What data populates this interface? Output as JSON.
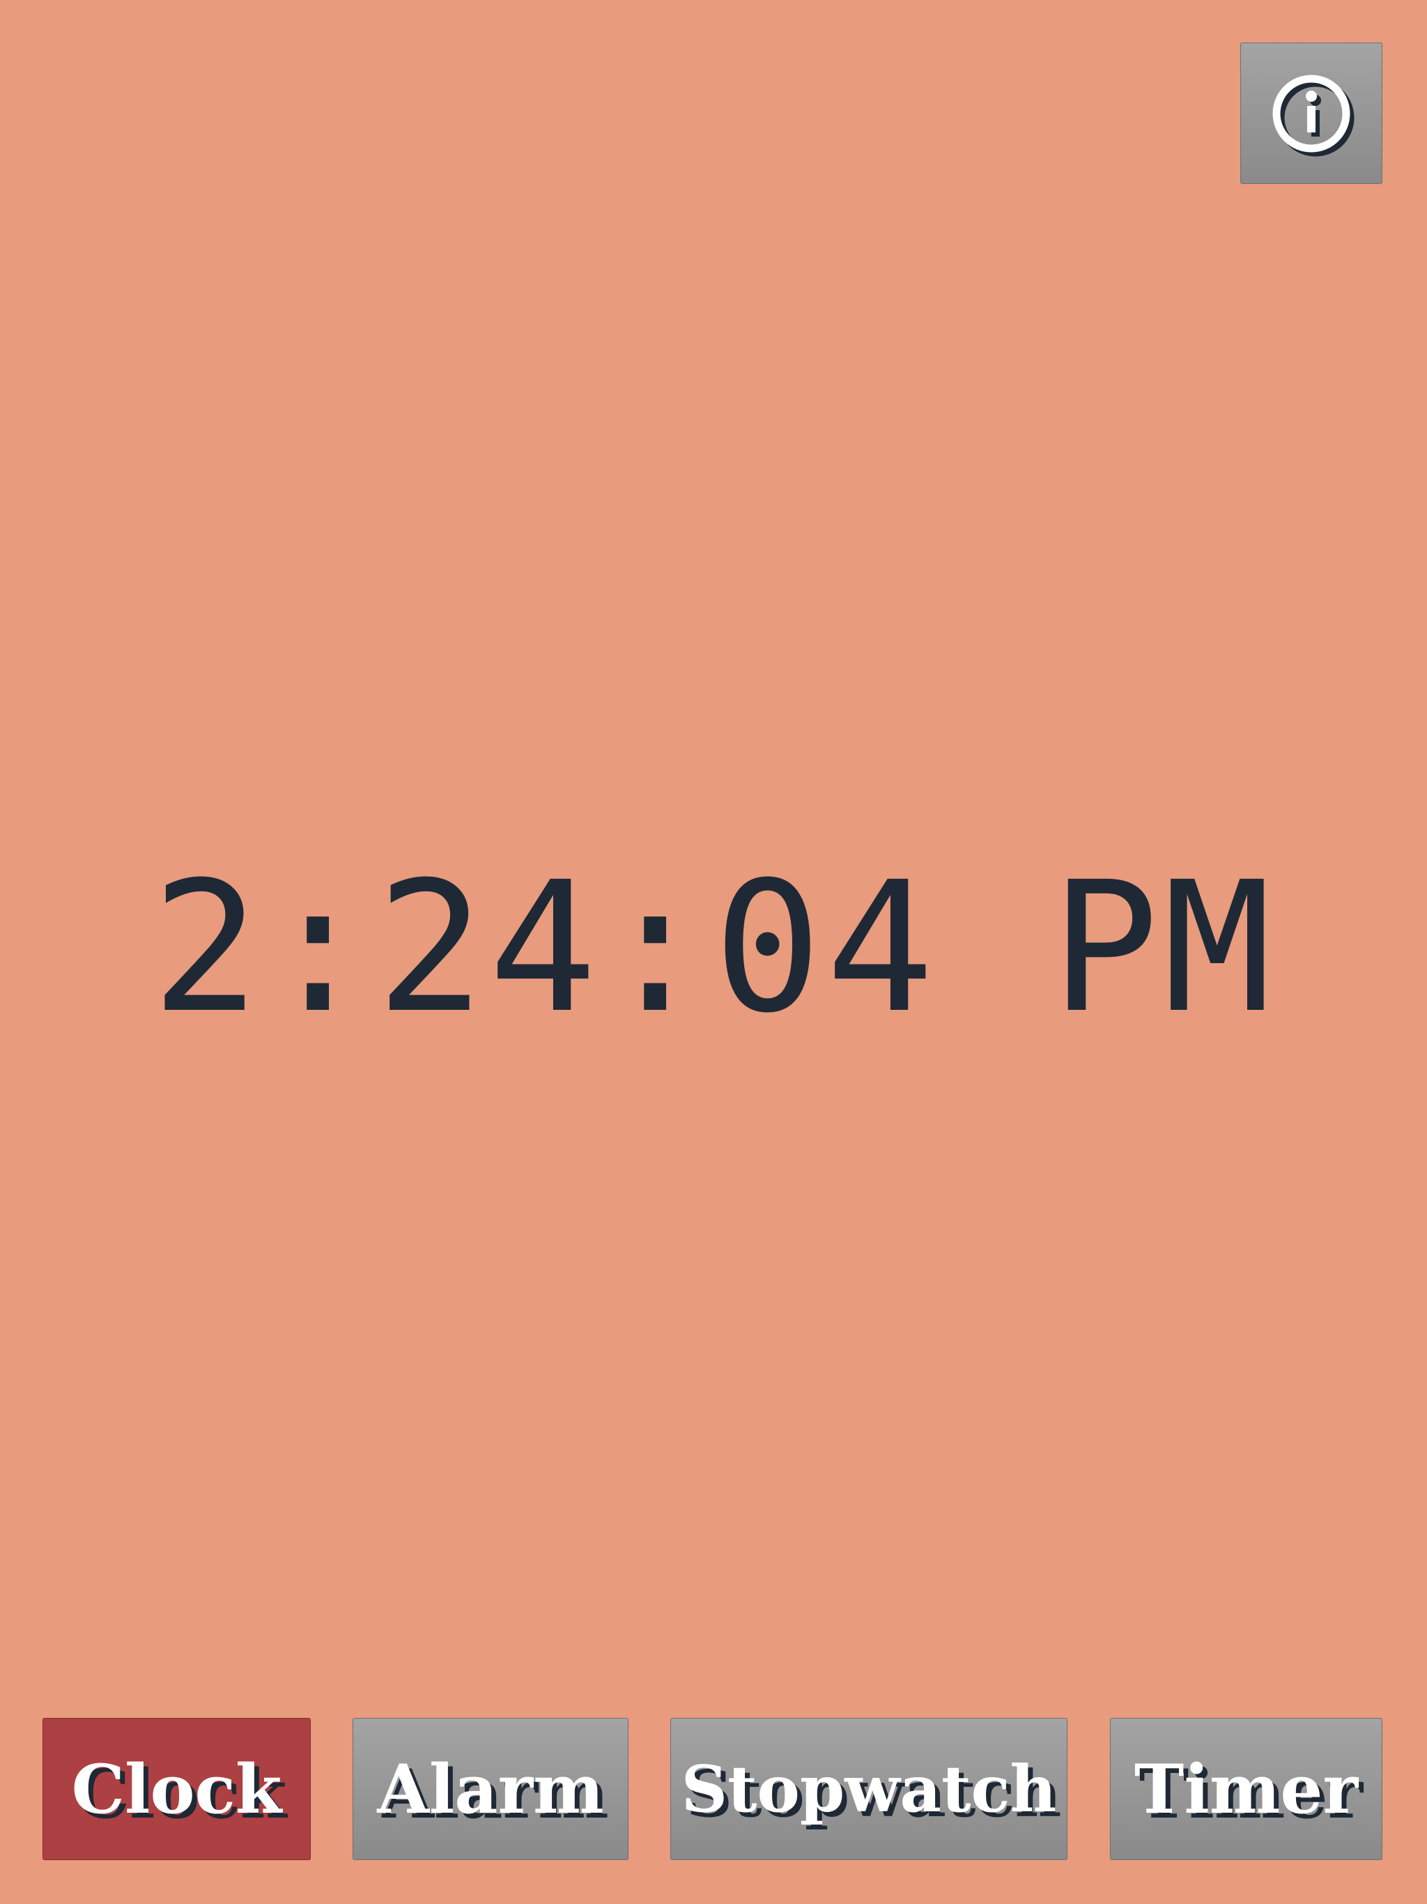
{
  "colors": {
    "background": "#e89b7d",
    "time_text": "#1e2935",
    "button_gray": "#9a9a9a",
    "active_button": "#ad4042",
    "button_text": "#ffffff",
    "text_shadow": "#1e2935"
  },
  "header": {
    "info_icon": "info-icon"
  },
  "clock": {
    "time": "2:24:04 PM"
  },
  "nav": {
    "active": "Clock",
    "clock_label": "Clock",
    "alarm_label": "Alarm",
    "stopwatch_label": "Stopwatch",
    "timer_label": "Timer"
  }
}
